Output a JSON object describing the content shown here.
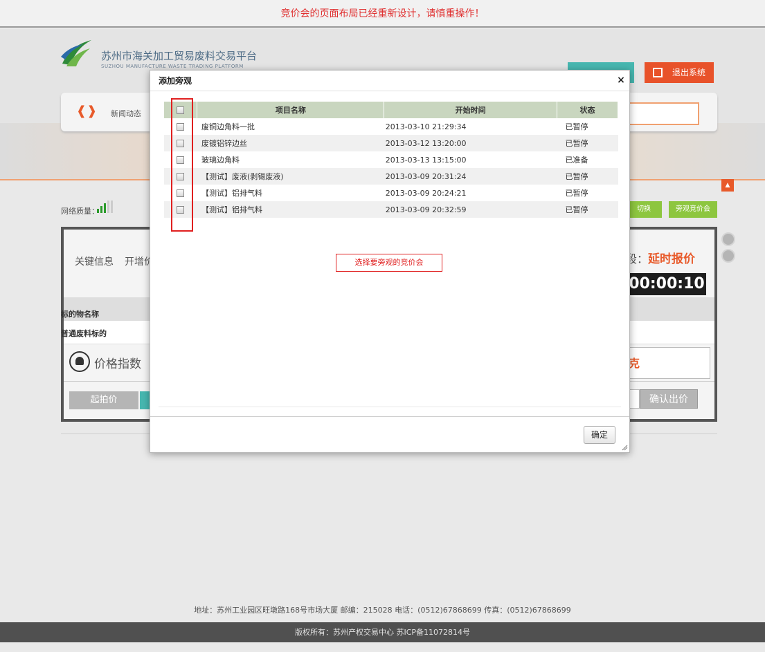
{
  "notice": "竞价会的页面布局已经重新设计，请慎重操作！",
  "header": {
    "logo_cn": "苏州市海关加工贸易废料交易平台",
    "logo_en": "SUZHOU MANUFACTURE WASTE TRADING PLATFORM",
    "logout_label": "退出系统",
    "nav_news": "新闻动态"
  },
  "background": {
    "network_label": "网络质量：",
    "switch_label": "切换",
    "watch_label": "旁观竞价会",
    "key_info": "关键信息",
    "open_add": "开增价",
    "stage_prefix": "段：",
    "stage_value": "延时报价",
    "timer": "00:00:10",
    "item_name_header": "标的物名称",
    "item_name_value": "普通废料标的",
    "price_index": "价格指数",
    "unit": "克",
    "start_price": "起拍价",
    "confirm_bid": "确认出价"
  },
  "footer": {
    "address": "地址：苏州工业园区旺墩路168号市场大厦 邮编：215028 电话：(0512)67868699 传真：(0512)67868699",
    "copyright": "版权所有：苏州产权交易中心 苏ICP备11072814号"
  },
  "dialog": {
    "title": "添加旁观",
    "close": "×",
    "columns": {
      "name": "项目名称",
      "time": "开始时间",
      "status": "状态"
    },
    "rows": [
      {
        "name": "废铜边角料一批",
        "time": "2013-03-10 21:29:34",
        "status": "已暂停"
      },
      {
        "name": "废镀铝锌边丝",
        "time": "2013-03-12 13:20:00",
        "status": "已暂停"
      },
      {
        "name": "玻璃边角料",
        "time": "2013-03-13 13:15:00",
        "status": "已准备"
      },
      {
        "name": "【测试】废液(剥锡废液)",
        "time": "2013-03-09 20:31:24",
        "status": "已暂停"
      },
      {
        "name": "【测试】铝排气料",
        "time": "2013-03-09 20:24:21",
        "status": "已暂停"
      },
      {
        "name": "【测试】铝排气料",
        "time": "2013-03-09 20:32:59",
        "status": "已暂停"
      }
    ],
    "hint": "选择要旁观的竞价会",
    "ok_label": "确定"
  },
  "colors": {
    "accent_orange": "#e85a2a",
    "notice_red": "#e03030",
    "header_green": "#c9d6bf",
    "highlight_red": "#e02020"
  }
}
